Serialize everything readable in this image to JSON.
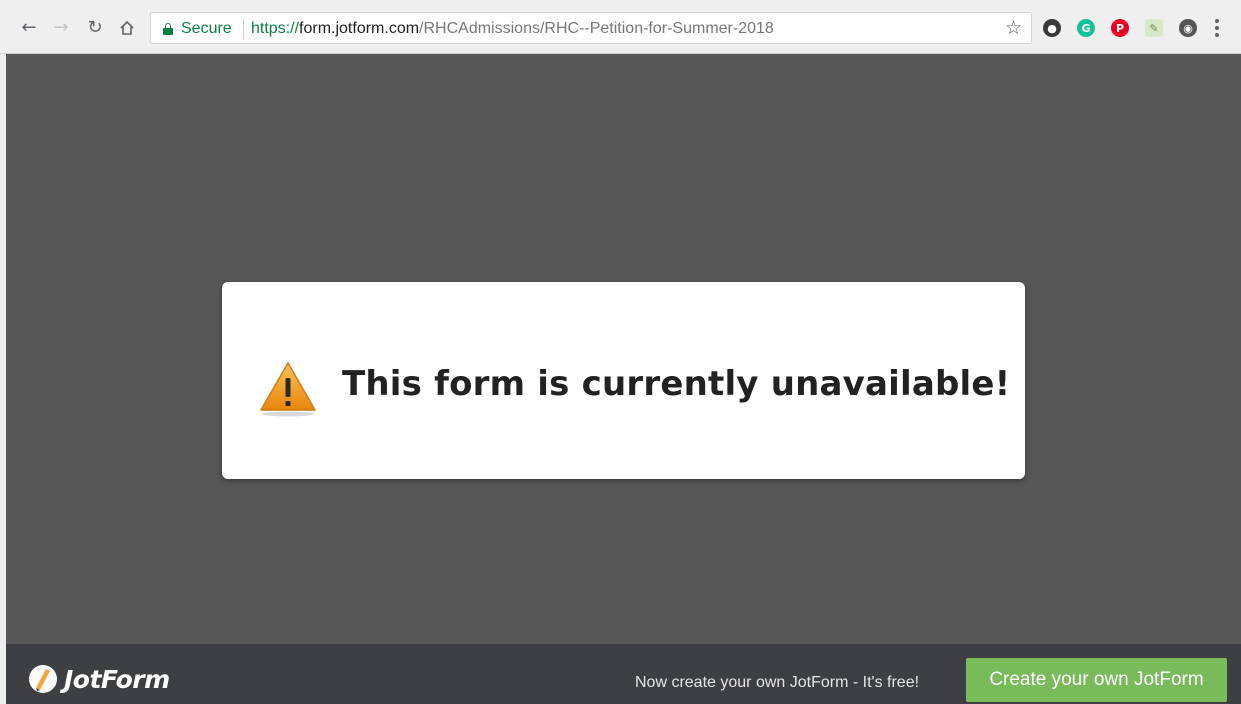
{
  "browser": {
    "secure_label": "Secure",
    "url_scheme": "https://",
    "url_host": "form.jotform.com",
    "url_path": "/RHCAdmissions/RHC--Petition-for-Summer-2018"
  },
  "icons": {
    "back": "arrow-left-icon",
    "forward": "arrow-right-icon",
    "reload": "reload-icon",
    "home": "home-icon",
    "lock": "lock-icon",
    "bookmark": "star-icon",
    "extensions": [
      "extension-icon",
      "grammarly-icon",
      "pinterest-icon",
      "notes-icon",
      "eye-icon"
    ],
    "menu": "more-vertical-icon",
    "warning": "warning-icon"
  },
  "notice": {
    "title": "This form is currently unavailable!"
  },
  "footer": {
    "logo_text": "JotForm",
    "promo_text": "Now create your own JotForm - It's free!",
    "cta_label": "Create your own JotForm"
  },
  "colors": {
    "page_background": "#575757",
    "footer_background": "#3e3f42",
    "cta_green": "#79bb5b",
    "secure_green": "#0b8043",
    "warning_orange": "#f39c12"
  }
}
